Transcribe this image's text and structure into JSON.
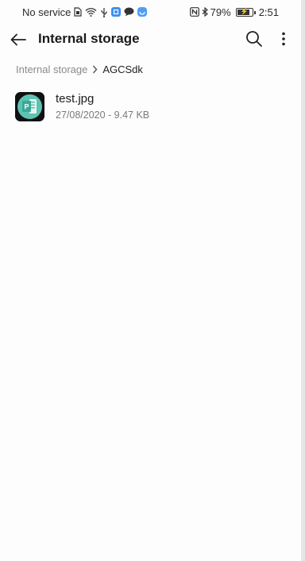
{
  "status_bar": {
    "carrier": "No service",
    "battery": "79%",
    "time": "2:51",
    "icons": [
      "sim-icon",
      "wifi-icon",
      "usb-icon",
      "app-notification-icon",
      "chat-icon",
      "app-badge-icon",
      "nfc-icon",
      "bluetooth-icon",
      "battery-icon"
    ]
  },
  "app_bar": {
    "title": "Internal storage",
    "icons": [
      "back-arrow-icon",
      "search-icon",
      "more-vert-icon"
    ]
  },
  "breadcrumb": {
    "root": "Internal storage",
    "current": "AGCSdk"
  },
  "files": [
    {
      "name": "test.jpg",
      "meta": "27/08/2020 - 9.47 KB",
      "icon": "image-file-icon"
    }
  ],
  "colors": {
    "icon_teal": "#5cc4b3",
    "badge_blue": "#3d8ef0"
  }
}
